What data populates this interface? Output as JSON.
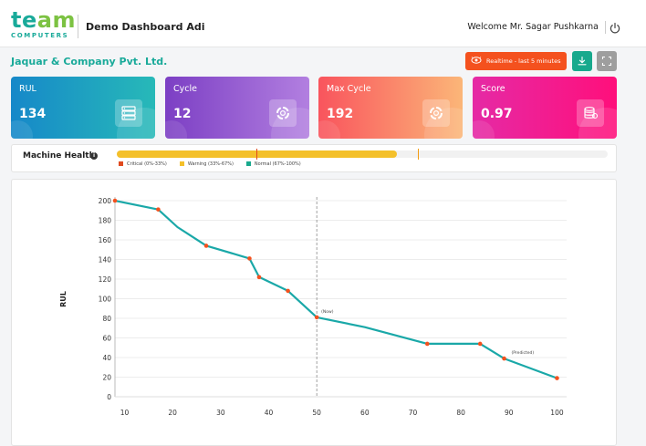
{
  "header": {
    "logo_word_a": "te",
    "logo_word_b": "am",
    "logo_sub": "COMPUTERS",
    "title": "Demo Dashboard Adi",
    "welcome": "Welcome Mr. Sagar Pushkarna"
  },
  "company": "Jaquar & Company Pvt. Ltd.",
  "toolbar": {
    "realtime_label": "Realtime - last 5 minutes"
  },
  "cards": [
    {
      "label": "RUL",
      "value": "134",
      "icon": "server-icon"
    },
    {
      "label": "Cycle",
      "value": "12",
      "icon": "cycle-icon"
    },
    {
      "label": "Max Cycle",
      "value": "192",
      "icon": "cycle-icon"
    },
    {
      "label": "Score",
      "value": "0.97",
      "icon": "coins-icon"
    }
  ],
  "health": {
    "label": "Machine Health",
    "fill_fraction": 0.57,
    "legend": [
      {
        "label": "Critical (0%-33%)",
        "color": "#e04a1f"
      },
      {
        "label": "Warning (33%-67%)",
        "color": "#f4c02a"
      },
      {
        "label": "Normal (67%-100%)",
        "color": "#18a98d"
      }
    ]
  },
  "colors": {
    "line": "#1aa8a8",
    "marker": "#f4511e",
    "accent": "#1aaa9a"
  },
  "chart_data": {
    "type": "line",
    "ylabel": "RUL",
    "xlabel": "",
    "xlim": [
      8,
      102
    ],
    "ylim": [
      0,
      200
    ],
    "x_ticks": [
      10,
      20,
      30,
      40,
      50,
      60,
      70,
      80,
      90,
      100
    ],
    "y_ticks": [
      0,
      20,
      40,
      60,
      80,
      100,
      120,
      140,
      160,
      180,
      200
    ],
    "now_x": 50,
    "now_label": "(Now)",
    "predicted_label": "(Predicted)",
    "series": [
      {
        "x": [
          8,
          17,
          21,
          27,
          36,
          38,
          44,
          50,
          60,
          73,
          84,
          89,
          100
        ],
        "y": [
          200,
          191,
          173,
          154,
          141,
          122,
          108,
          81,
          71,
          54,
          54,
          39,
          19
        ],
        "markers": [
          true,
          true,
          false,
          true,
          true,
          true,
          true,
          true,
          false,
          true,
          true,
          true,
          true
        ]
      }
    ]
  }
}
